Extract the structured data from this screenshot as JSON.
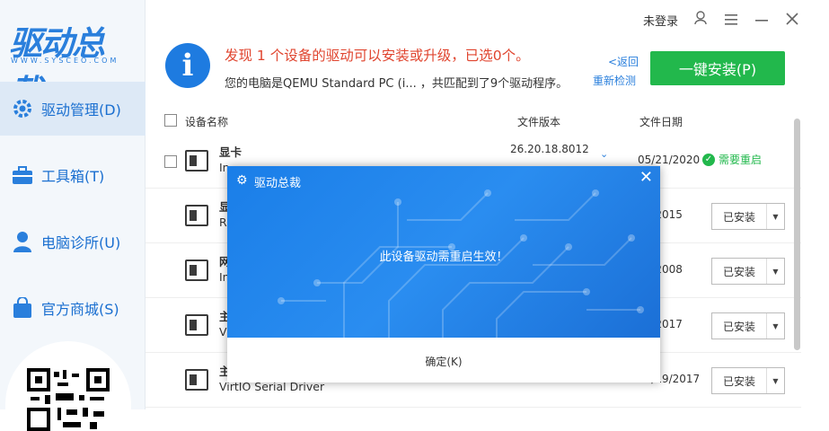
{
  "app": {
    "logo_text": "驱动总裁",
    "logo_sub": "WWW.SYSCEO.COM"
  },
  "sidebar": {
    "items": [
      {
        "label": "驱动管理(D)",
        "icon": "gear-icon",
        "active": true
      },
      {
        "label": "工具箱(T)",
        "icon": "toolbox-icon",
        "active": false
      },
      {
        "label": "电脑诊所(U)",
        "icon": "person-icon",
        "active": false
      },
      {
        "label": "官方商城(S)",
        "icon": "shopping-bag-icon",
        "active": false
      }
    ]
  },
  "topbar": {
    "login_status": "未登录"
  },
  "header": {
    "headline": "发现 1 个设备的驱动可以安装或升级，已选0个。",
    "subline": "您的电脑是QEMU Standard PC (i... ，共匹配到了9个驱动程序。",
    "back_link": "<返回",
    "redetect_link": "重新检测",
    "install_all_button": "一键安装(P)"
  },
  "table": {
    "columns": [
      "设备名称",
      "文件版本",
      "文件日期"
    ],
    "rows": [
      {
        "name": "显卡",
        "sub": "In",
        "version": "26.20.18.8012",
        "date": "05/21/2020",
        "status": "需要重启",
        "action": ""
      },
      {
        "name": "显",
        "sub": "Rl",
        "version": "",
        "date": "22/2015",
        "status": "",
        "action": "已安装"
      },
      {
        "name": "网",
        "sub": "In",
        "version": "",
        "date": "23/2008",
        "status": "",
        "action": "已安装"
      },
      {
        "name": "主",
        "sub": "Vi",
        "version": "",
        "date": "19/2017",
        "status": "",
        "action": "已安装"
      },
      {
        "name": "主",
        "sub": "VirtIO Serial Driver",
        "version": "",
        "date": "07/19/2017",
        "status": "",
        "action": "已安装"
      }
    ]
  },
  "modal": {
    "title": "驱动总裁",
    "message": "此设备驱动需重启生效！",
    "ok_button": "确定(K)"
  },
  "colors": {
    "accent": "#2a7fdc",
    "install_green": "#22b84c",
    "headline_red": "#e0452f",
    "modal_blue": "#1e80e8"
  }
}
